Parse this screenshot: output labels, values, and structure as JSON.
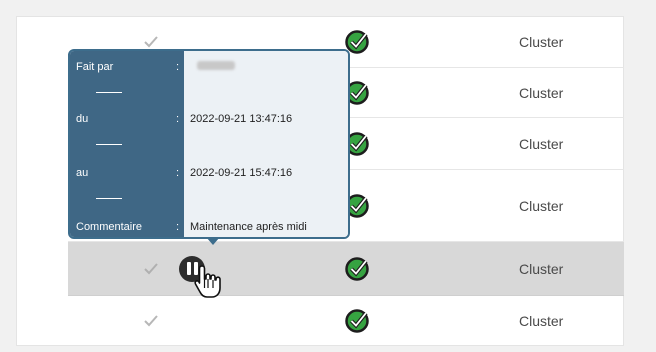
{
  "rows": [
    {
      "type": "Cluster",
      "hover": false
    },
    {
      "type": "Cluster",
      "hover": false
    },
    {
      "type": "Cluster",
      "hover": false
    },
    {
      "type": "Cluster",
      "hover": false
    },
    {
      "type": "Cluster",
      "hover": true
    },
    {
      "type": "Cluster",
      "hover": false
    }
  ],
  "tooltip": {
    "fait_par_label": "Fait par",
    "du_label": "du",
    "au_label": "au",
    "commentaire_label": "Commentaire",
    "colon": ":",
    "du_value": "2022-09-21 13:47:16",
    "au_value": "2022-09-21 15:47:16",
    "commentaire_value": "Maintenance après midi"
  },
  "colors": {
    "status_ok": "#36a341",
    "tooltip_bg": "#3f6785",
    "hover_row": "#d8d8d8"
  },
  "icons": {
    "check": "check-icon",
    "status": "status-ok-icon",
    "pause": "pause-icon",
    "cursor": "hand-cursor-icon"
  }
}
